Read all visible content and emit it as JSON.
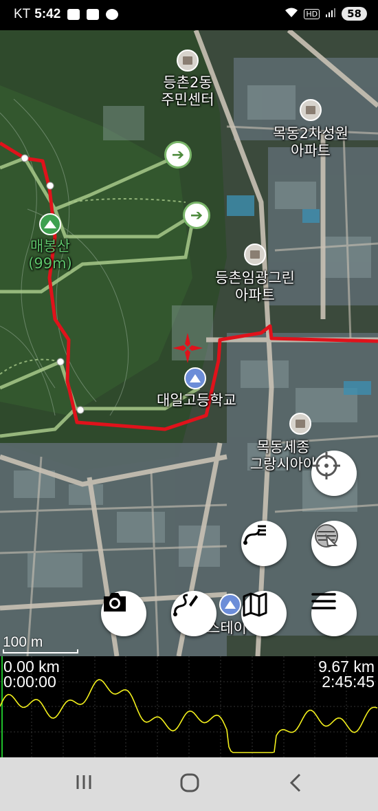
{
  "status_bar": {
    "carrier": "KT",
    "time": "5:42",
    "battery": "58",
    "hd_label": "HD"
  },
  "map": {
    "pois": [
      {
        "name": "등촌2동\n주민센터",
        "type": "public-building"
      },
      {
        "name": "목동2차성원\n아파트",
        "type": "apartment"
      },
      {
        "name": "등촌임광그린\n아파트",
        "type": "apartment"
      },
      {
        "name": "대일고등학교",
        "type": "school"
      },
      {
        "name": "목동세종\n그랑시아아",
        "type": "apartment"
      },
      {
        "name": "스테이",
        "type": "shop"
      }
    ],
    "peak": {
      "name": "매봉산",
      "elevation": "(99m)"
    },
    "scale_label": "100 m"
  },
  "buttons": {
    "locate": "locate-button",
    "track_list": "track-list-button",
    "layers": "map-layers-button",
    "camera": "camera-button",
    "route_edit": "route-edit-button",
    "map": "map-button",
    "menu": "menu-button"
  },
  "profile": {
    "start_distance": "0.00 km",
    "start_time": "0:00:00",
    "end_distance": "9.67 km",
    "end_time": "2:45:45",
    "line_color": "#f4f11c"
  },
  "colors": {
    "route": "#e0121b",
    "trail": "#a8c98a",
    "road": "#c9c1b4"
  }
}
